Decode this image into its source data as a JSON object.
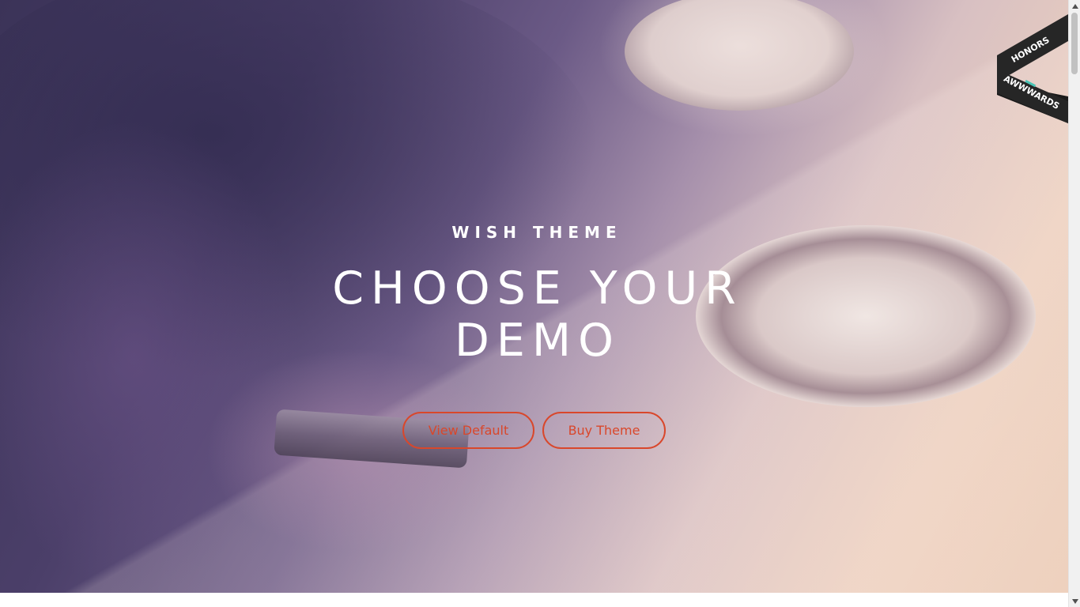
{
  "hero": {
    "eyebrow": "WISH THEME",
    "headline": "CHOOSE YOUR DEMO",
    "buttons": {
      "view_default": "View Default",
      "buy_theme": "Buy Theme"
    }
  },
  "ribbon": {
    "honors": "HONORS",
    "brand": "AWWWARDS",
    "icon": "awwwards-honors-ribbon"
  },
  "colors": {
    "accent": "#d9472b",
    "text": "#ffffff",
    "ribbon_bg": "#262626",
    "ribbon_teal": "#49c5b6"
  },
  "scrollbar": {
    "up_icon": "triangle-up-icon",
    "down_icon": "triangle-down-icon"
  }
}
